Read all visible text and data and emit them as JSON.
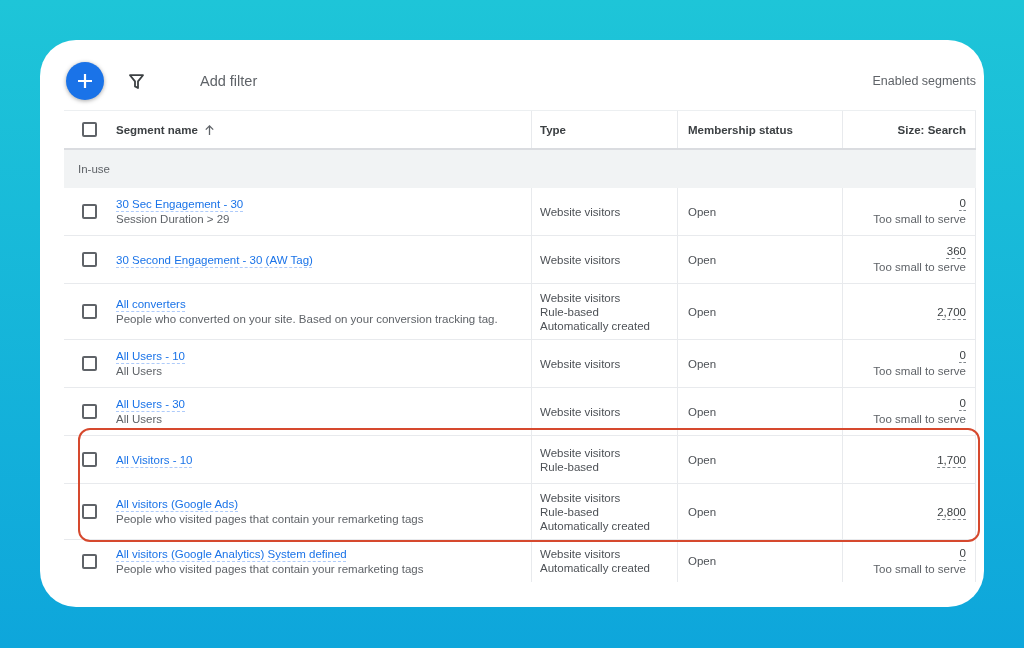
{
  "toolbar": {
    "add_filter": "Add filter",
    "segment_view": "Enabled segments"
  },
  "table": {
    "select_all": {
      "checked": false
    },
    "columns": [
      {
        "label": "Segment name",
        "sorted": true
      },
      {
        "label": "Type",
        "sorted": false
      },
      {
        "label": "Membership status",
        "sorted": false
      },
      {
        "label": "Size: Search",
        "sorted": false
      }
    ],
    "group": {
      "label": "In-use"
    },
    "rows": [
      {
        "name": "30 Sec Engagement - 30",
        "description": "Session Duration > 29",
        "type": [
          "Website visitors"
        ],
        "membership": "Open",
        "size": "0",
        "size_note": "Too small to serve",
        "checked": false,
        "highlighted": false
      },
      {
        "name": "30 Second Engagement - 30 (AW Tag)",
        "type": [
          "Website visitors"
        ],
        "membership": "Open",
        "size": "360",
        "size_note": "Too small to serve",
        "checked": false,
        "highlighted": false
      },
      {
        "name": "All converters",
        "description": "People who converted on your site. Based on your conversion tracking tag.",
        "type": [
          "Website visitors",
          "Rule-based",
          "Automatically created"
        ],
        "membership": "Open",
        "size": "2,700",
        "checked": false,
        "highlighted": false
      },
      {
        "name": "All Users - 10",
        "description": "All Users",
        "type": [
          "Website visitors"
        ],
        "membership": "Open",
        "size": "0",
        "size_note": "Too small to serve",
        "checked": false,
        "highlighted": false
      },
      {
        "name": "All Users - 30",
        "description": "All Users",
        "type": [
          "Website visitors"
        ],
        "membership": "Open",
        "size": "0",
        "size_note": "Too small to serve",
        "checked": false,
        "highlighted": false
      },
      {
        "name": "All Visitors - 10",
        "type": [
          "Website visitors",
          "Rule-based"
        ],
        "membership": "Open",
        "size": "1,700",
        "checked": false,
        "highlighted": true
      },
      {
        "name": "All visitors (Google Ads)",
        "description": "People who visited pages that contain your remarketing tags",
        "type": [
          "Website visitors",
          "Rule-based",
          "Automatically created"
        ],
        "membership": "Open",
        "size": "2,800",
        "checked": false,
        "highlighted": true
      },
      {
        "name": "All visitors (Google Analytics) System defined",
        "description": "People who visited pages that contain your remarketing tags",
        "type": [
          "Website visitors",
          "Automatically created"
        ],
        "membership": "Open",
        "size": "0",
        "size_note": "Too small to serve",
        "checked": false,
        "highlighted": false
      }
    ]
  }
}
